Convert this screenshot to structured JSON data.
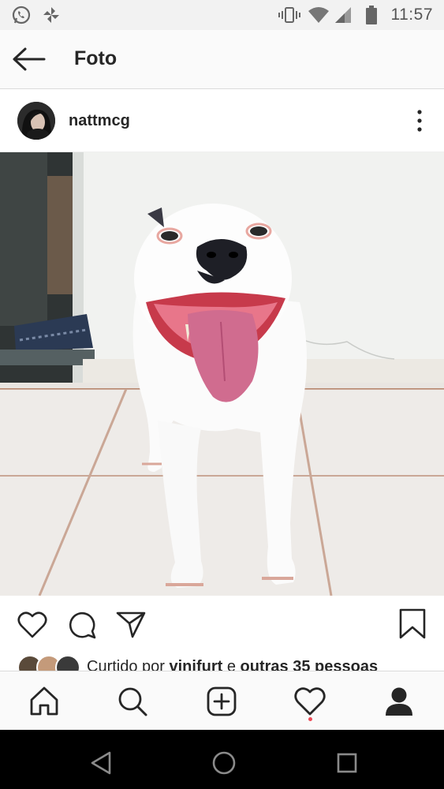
{
  "status_bar": {
    "time": "11:57",
    "icons": [
      "whatsapp-icon",
      "pinwheel-icon",
      "vibrate-icon",
      "wifi-icon",
      "cell-signal-icon",
      "battery-icon"
    ]
  },
  "header": {
    "title": "Foto",
    "back_icon": "arrow-left-icon"
  },
  "post": {
    "username": "nattmcg",
    "more_icon": "more-vertical-icon",
    "photo_description_icon": "dog-photo"
  },
  "actions": {
    "icons": [
      "heart-icon",
      "comment-icon",
      "share-icon",
      "bookmark-icon"
    ]
  },
  "likes": {
    "prefix": "Curtido por ",
    "user": "vinifurt",
    "connector": " e ",
    "others": "outras 35 pessoas"
  },
  "bottom_nav": {
    "items": [
      "home-icon",
      "search-icon",
      "add-post-icon",
      "activity-heart-icon",
      "profile-icon"
    ]
  },
  "android_nav": {
    "items": [
      "back-triangle-icon",
      "home-circle-icon",
      "recents-square-icon"
    ]
  },
  "colors": {
    "status_bar_bg": "#f2f2f2",
    "header_bg": "#fafafa",
    "text": "#262626",
    "notification_dot": "#ed4956",
    "android_nav_bg": "#000000"
  }
}
